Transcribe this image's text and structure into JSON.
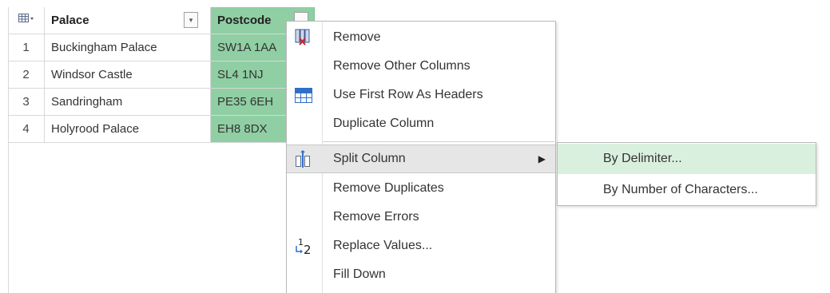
{
  "grid": {
    "header": {
      "table_icon": "table-icon",
      "columns": [
        "Palace",
        "Postcode"
      ],
      "filter_glyph": "▾"
    },
    "rows": [
      {
        "index": "1",
        "palace": "Buckingham Palace",
        "postcode": "SW1A 1AA"
      },
      {
        "index": "2",
        "palace": "Windsor Castle",
        "postcode": "SL4 1NJ"
      },
      {
        "index": "3",
        "palace": "Sandringham",
        "postcode": "PE35 6EH"
      },
      {
        "index": "4",
        "palace": "Holyrood Palace",
        "postcode": "EH8 8DX"
      }
    ],
    "selected_column_color": "#8fcfa3"
  },
  "context_menu": {
    "items": [
      {
        "label": "Remove",
        "icon": "remove-columns-icon"
      },
      {
        "label": "Remove Other Columns",
        "icon": ""
      },
      {
        "label": "Use First Row As Headers",
        "icon": "table-header-icon"
      },
      {
        "label": "Duplicate Column",
        "icon": ""
      },
      {
        "label": "Split Column",
        "icon": "split-column-icon",
        "has_submenu": true,
        "arrow": "▶"
      },
      {
        "label": "Remove Duplicates",
        "icon": ""
      },
      {
        "label": "Remove Errors",
        "icon": ""
      },
      {
        "label": "Replace Values...",
        "icon": "replace-values-icon"
      },
      {
        "label": "Fill Down",
        "icon": ""
      }
    ],
    "highlight_color": "#e6e6e6"
  },
  "split_submenu": {
    "items": [
      {
        "label": "By Delimiter...",
        "highlighted": true
      },
      {
        "label": "By Number of Characters...",
        "highlighted": false
      }
    ],
    "highlight_color": "#daf0df"
  }
}
